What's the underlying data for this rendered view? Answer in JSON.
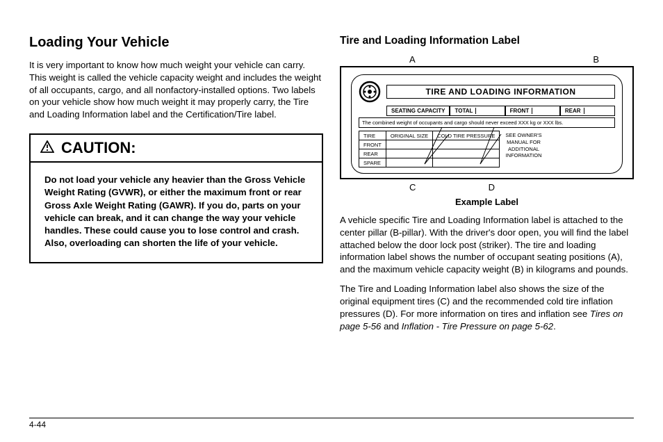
{
  "left": {
    "heading": "Loading Your Vehicle",
    "intro": "It is very important to know how much weight your vehicle can carry. This weight is called the vehicle capacity weight and includes the weight of all occupants, cargo, and all nonfactory-installed options. Two labels on your vehicle show how much weight it may properly carry, the Tire and Loading Information label and the Certification/Tire label.",
    "caution_title": "CAUTION:",
    "caution_body": "Do not load your vehicle any heavier than the Gross Vehicle Weight Rating (GVWR), or either the maximum front or rear Gross Axle Weight Rating (GAWR). If you do, parts on your vehicle can break, and it can change the way your vehicle handles. These could cause you to lose control and crash. Also, overloading can shorten the life of your vehicle."
  },
  "right": {
    "heading": "Tire and Loading Information Label",
    "markers": {
      "A": "A",
      "B": "B",
      "C": "C",
      "D": "D"
    },
    "label": {
      "title": "TIRE AND LOADING INFORMATION",
      "seating_capacity": "SEATING CAPACITY",
      "total": "TOTAL",
      "front": "FRONT",
      "rear": "REAR",
      "combined": "The combined weight of occupants and cargo should never exceed  XXX kg or XXX lbs.",
      "cols": {
        "tire": "TIRE",
        "size": "ORIGINAL SIZE",
        "pressure": "COLD TIRE PRESSURE"
      },
      "rows": [
        "FRONT",
        "REAR",
        "SPARE"
      ],
      "owners": [
        "SEE OWNER'S",
        "MANUAL FOR",
        "ADDITIONAL",
        "INFORMATION"
      ]
    },
    "caption": "Example Label",
    "para1": "A vehicle specific Tire and Loading Information label is attached to the center pillar (B-pillar). With the driver's door open, you will find the label attached below the door lock post (striker). The tire and loading information label shows the number of occupant seating positions (A), and the maximum vehicle capacity weight (B) in kilograms and pounds.",
    "para2_a": "The Tire and Loading Information label also shows the size of the original equipment tires (C) and the recommended cold tire inflation pressures (D). For more information on tires and inflation see ",
    "para2_ref1": "Tires on page 5-56",
    "para2_b": " and ",
    "para2_ref2": "Inflation - Tire Pressure on page 5-62",
    "para2_c": "."
  },
  "page_number": "4-44"
}
